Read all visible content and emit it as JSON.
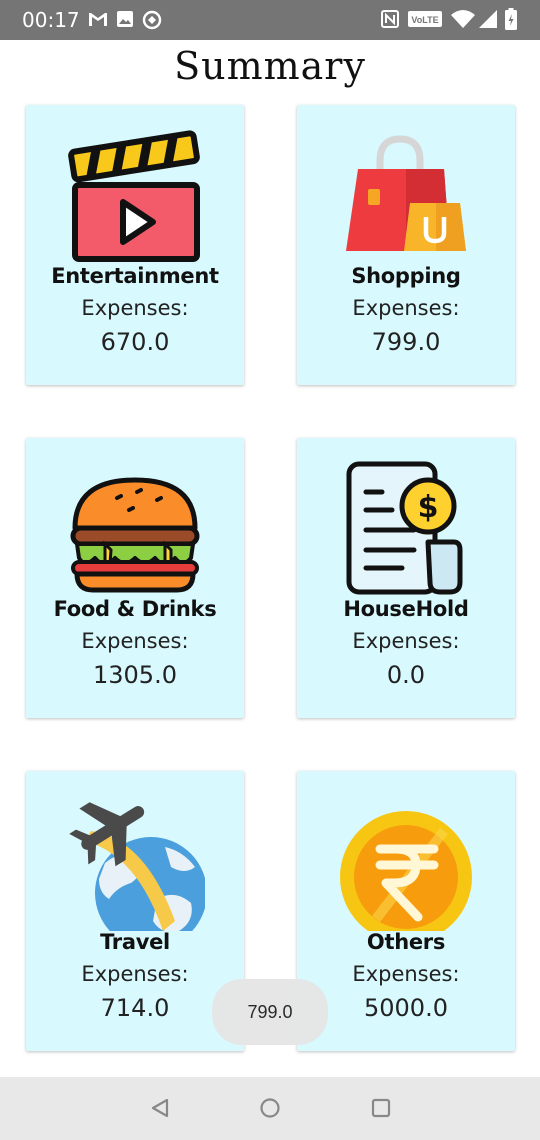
{
  "status_bar": {
    "time": "00:17",
    "left_icons": [
      "gmail-icon",
      "image-icon",
      "sync-icon"
    ],
    "right_icons": [
      "nfc-icon",
      "volte-icon",
      "wifi-icon",
      "signal-icon",
      "battery-icon"
    ],
    "volte_label": "VoLTE"
  },
  "page": {
    "title": "Summary"
  },
  "cards": [
    {
      "name": "Entertainment",
      "label": "Expenses:",
      "value": "670.0",
      "icon": "clapperboard-icon"
    },
    {
      "name": "Shopping",
      "label": "Expenses:",
      "value": "799.0",
      "icon": "shopping-bag-icon"
    },
    {
      "name": "Food & Drinks",
      "label": "Expenses:",
      "value": "1305.0",
      "icon": "burger-icon"
    },
    {
      "name": "HouseHold",
      "label": "Expenses:",
      "value": "0.0",
      "icon": "bill-icon"
    },
    {
      "name": "Travel",
      "label": "Expenses:",
      "value": "714.0",
      "icon": "airplane-globe-icon"
    },
    {
      "name": "Others",
      "label": "Expenses:",
      "value": "5000.0",
      "icon": "rupee-coin-icon"
    }
  ],
  "toast": {
    "text": "799.0"
  },
  "nav_bar": {
    "buttons": [
      "back-icon",
      "home-icon",
      "recents-icon"
    ]
  }
}
